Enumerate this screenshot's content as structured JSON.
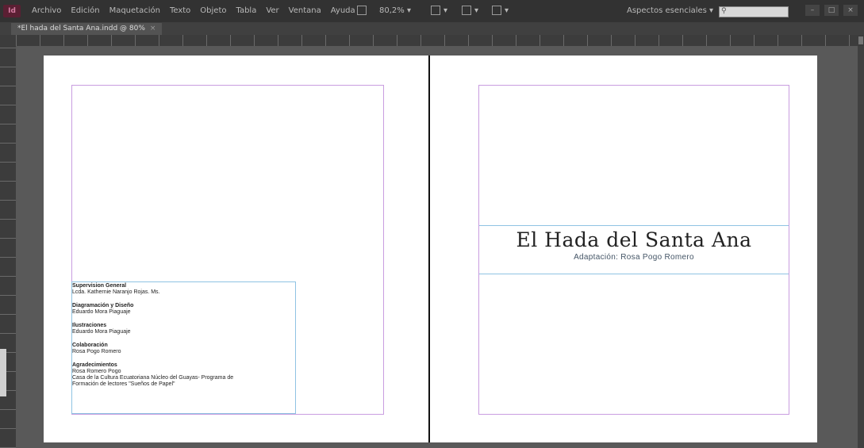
{
  "menubar": {
    "logo": "Id",
    "menus": [
      "Archivo",
      "Edición",
      "Maquetación",
      "Texto",
      "Objeto",
      "Tabla",
      "Ver",
      "Ventana",
      "Ayuda"
    ],
    "zoom_label": "80,2%",
    "workspace": "Aspectos esenciales",
    "search_placeholder": ""
  },
  "tab": {
    "title": "*El hada del Santa Ana.indd @ 80%"
  },
  "page_right": {
    "title": "El Hada del Santa Ana",
    "subtitle": "Adaptación: Rosa Pogo Romero"
  },
  "credits": [
    {
      "heading": "Supervision General",
      "lines": [
        "Lcda. Kathernie Naranjo Rojas. Ms."
      ]
    },
    {
      "heading": "Diagramación y Diseño",
      "lines": [
        "Eduardo Mora Piaguaje"
      ]
    },
    {
      "heading": "Ilustraciones",
      "lines": [
        "Eduardo Mora Piaguaje"
      ]
    },
    {
      "heading": "Colaboración",
      "lines": [
        "Rosa Pogo Romero"
      ]
    },
    {
      "heading": "Agradecimientos",
      "lines": [
        "Rosa Romero Pogo",
        "Casa de la Cultura Ecuatoriana Núcleo del Guayas- Programa de",
        "Formación de lectores \"Sueños de Papel\""
      ]
    }
  ],
  "colors": {
    "margin_guide": "#c99de0",
    "frame_guide": "#8fc3e3",
    "pasteboard": "#595959",
    "menubar": "#323232"
  }
}
